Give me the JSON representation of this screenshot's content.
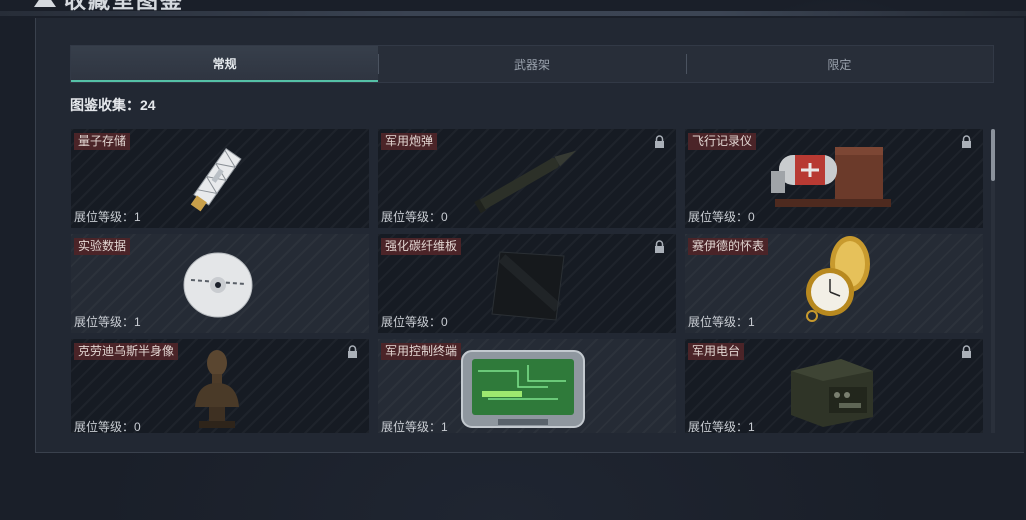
{
  "title": "收藏室图鉴",
  "tabs": [
    {
      "label": "常规",
      "active": true
    },
    {
      "label": "武器架",
      "active": false
    },
    {
      "label": "限定",
      "active": false
    }
  ],
  "collection": {
    "label": "图鉴收集：24"
  },
  "accent_color": "#55c1a7",
  "items": [
    {
      "name": "量子存储",
      "level": "展位等级：1",
      "locked": false,
      "icon": "usb-drive-icon"
    },
    {
      "name": "军用炮弹",
      "level": "展位等级：0",
      "locked": true,
      "icon": "artillery-shell-icon"
    },
    {
      "name": "飞行记录仪",
      "level": "展位等级：0",
      "locked": true,
      "icon": "flight-recorder-icon"
    },
    {
      "name": "实验数据",
      "level": "展位等级：1",
      "locked": false,
      "icon": "disc-icon"
    },
    {
      "name": "强化碳纤维板",
      "level": "展位等级：0",
      "locked": true,
      "icon": "carbon-plate-icon"
    },
    {
      "name": "赛伊德的怀表",
      "level": "展位等级：1",
      "locked": false,
      "icon": "pocket-watch-icon"
    },
    {
      "name": "克劳迪乌斯半身像",
      "level": "展位等级：0",
      "locked": true,
      "icon": "bust-icon"
    },
    {
      "name": "军用控制终端",
      "level": "展位等级：1",
      "locked": false,
      "icon": "control-terminal-icon"
    },
    {
      "name": "军用电台",
      "level": "展位等级：1",
      "locked": true,
      "icon": "radio-icon"
    }
  ]
}
